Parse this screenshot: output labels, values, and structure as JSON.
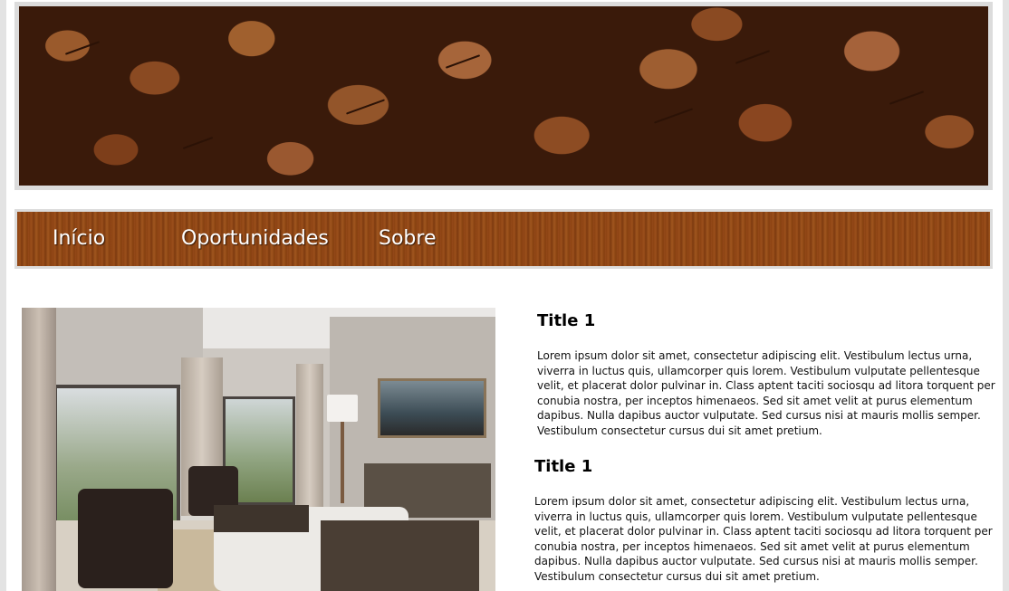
{
  "banner": {
    "image": "coffee-beans-photo"
  },
  "nav": {
    "items": [
      {
        "label": "Início"
      },
      {
        "label": "Oportunidades"
      },
      {
        "label": "Sobre"
      }
    ]
  },
  "main": {
    "photo": "living-room-photo",
    "sections": [
      {
        "title": "Title 1",
        "lines": [
          "Lorem ipsum dolor sit amet, consectetur adipiscing elit. Vestibulum lectus urna,",
          "viverra in luctus quis, ullamcorper quis lorem. Vestibulum vulputate pellentesque",
          "velit, et placerat dolor pulvinar in. Class aptent taciti sociosqu ad litora torquent per",
          "conubia nostra, per inceptos himenaeos. Sed sit amet velit at purus elementum",
          "dapibus. Nulla dapibus auctor vulputate. Sed cursus nisi at mauris mollis semper.",
          "Vestibulum consectetur cursus dui sit amet pretium."
        ]
      },
      {
        "title": "Title 1",
        "lines": [
          "Lorem ipsum dolor sit amet, consectetur adipiscing elit. Vestibulum lectus urna,",
          "viverra in luctus quis, ullamcorper quis lorem. Vestibulum vulputate pellentesque",
          "velit, et placerat dolor pulvinar in. Class aptent taciti sociosqu ad litora torquent per",
          "conubia nostra, per inceptos himenaeos. Sed sit amet velit at purus elementum",
          "dapibus. Nulla dapibus auctor vulputate. Sed cursus nisi at mauris mollis semper.",
          "Vestibulum consectetur cursus dui sit amet pretium."
        ]
      }
    ]
  },
  "colors": {
    "nav_wood": "#8c4313",
    "frame": "#dcdcdc",
    "text": "#111111"
  }
}
